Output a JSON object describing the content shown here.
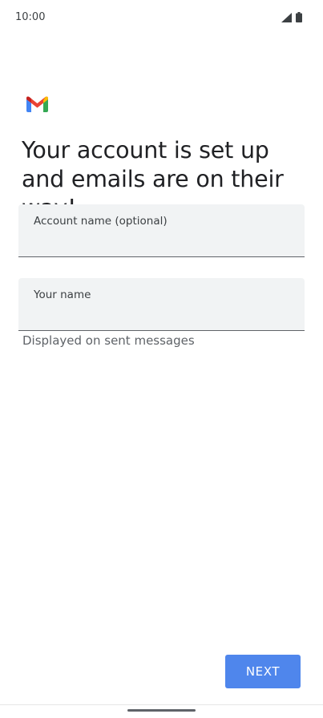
{
  "status_bar": {
    "time": "10:00",
    "icons": [
      "signal-icon",
      "battery-icon"
    ]
  },
  "logo": {
    "icon": "gmail-logo-icon",
    "colors": {
      "blue": "#4285f4",
      "red": "#ea4335",
      "yellow": "#fbbc04",
      "green": "#34a853",
      "dark_red": "#c5221f"
    }
  },
  "setup": {
    "headline": "Your account is set up and emails are on their way!"
  },
  "fields": {
    "account_name": {
      "label": "Account name (optional)",
      "value": ""
    },
    "your_name": {
      "label": "Your name",
      "value": "",
      "helper": "Displayed on sent messages"
    }
  },
  "actions": {
    "next_label": "NEXT",
    "accent_color": "#4f86ec"
  }
}
